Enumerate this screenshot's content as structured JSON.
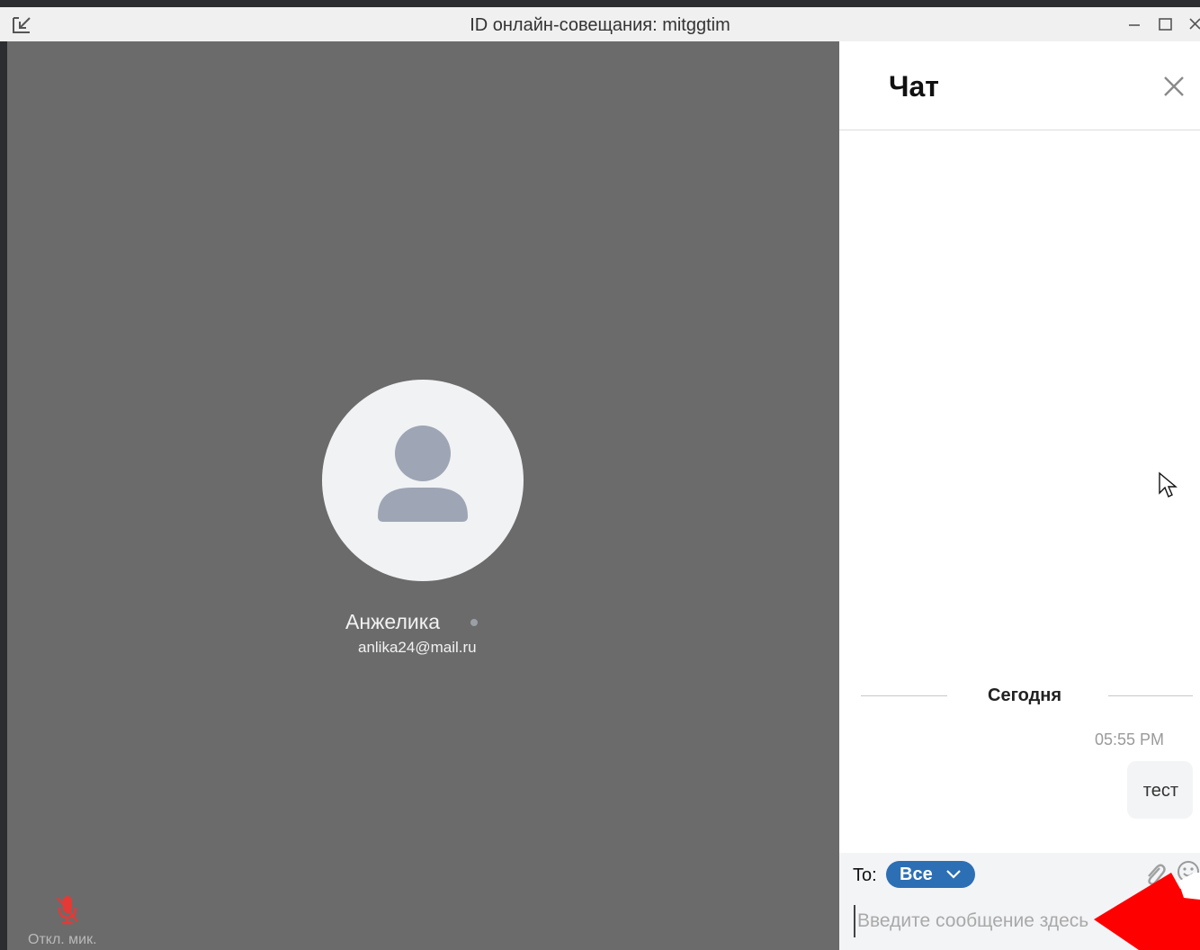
{
  "window": {
    "title": "ID онлайн-совещания: mitggtim"
  },
  "participant": {
    "name": "Анжелика",
    "email": "anlika24@mail.ru"
  },
  "controls": {
    "mic_label": "Откл. мик."
  },
  "chat": {
    "title": "Чат",
    "date_divider": "Сегодня",
    "messages": [
      {
        "time": "05:55 PM",
        "text": "тест"
      }
    ],
    "composer": {
      "to_label": "To:",
      "to_value": "Все",
      "placeholder": "Введите сообщение здесь"
    }
  },
  "colors": {
    "video_bg": "#6b6b6b",
    "accent": "#2c6fb5",
    "mic_muted": "#e53935",
    "annotation_arrow": "#ff0000"
  },
  "icons": [
    "exit-fullscreen-icon",
    "minimize-icon",
    "maximize-icon",
    "close-window-icon",
    "person-icon",
    "mic-off-icon",
    "close-icon",
    "cursor-icon",
    "chevron-down-icon",
    "attach-icon",
    "emoji-icon"
  ]
}
